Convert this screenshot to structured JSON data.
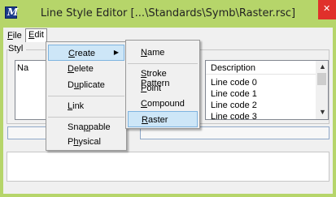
{
  "window": {
    "title": "Line Style Editor [...\\Standards\\Symb\\Raster.rsc]",
    "close_glyph": "✕",
    "app_icon_glyph": "M",
    "colors": {
      "titlebar": "#b6d56a",
      "close": "#e0302b",
      "highlight": "#cde6f7"
    }
  },
  "menubar": {
    "file": {
      "hotkey": "F",
      "rest": "ile"
    },
    "edit": {
      "hotkey": "E",
      "rest": "dit"
    }
  },
  "styles_label": "Styl",
  "left_list": {
    "header": "Na"
  },
  "right_list": {
    "header": "Description",
    "rows": [
      "Line code 0",
      "Line code 1",
      "Line code 2",
      "Line code 3"
    ]
  },
  "edit_menu": {
    "items": [
      {
        "pre": "",
        "hotkey": "C",
        "post": "reate",
        "has_submenu": true,
        "highlighted": true
      },
      {
        "pre": "",
        "hotkey": "D",
        "post": "elete"
      },
      {
        "pre": "D",
        "hotkey": "u",
        "post": "plicate"
      },
      {
        "pre": "",
        "hotkey": "L",
        "post": "ink"
      },
      {
        "pre": "Sna",
        "hotkey": "p",
        "post": "pable"
      },
      {
        "pre": "P",
        "hotkey": "h",
        "post": "ysical"
      }
    ]
  },
  "create_menu": {
    "items": [
      {
        "pre": "",
        "hotkey": "N",
        "post": "ame"
      },
      {
        "pre": "",
        "hotkey": "S",
        "post": "troke Pattern"
      },
      {
        "pre": "",
        "hotkey": "P",
        "post": "oint"
      },
      {
        "pre": "",
        "hotkey": "C",
        "post": "ompound"
      },
      {
        "pre": "",
        "hotkey": "R",
        "post": "aster",
        "highlighted": true
      }
    ]
  },
  "icons": {
    "submenu_arrow": "▶",
    "scroll_up": "▲",
    "scroll_down": "▼"
  }
}
